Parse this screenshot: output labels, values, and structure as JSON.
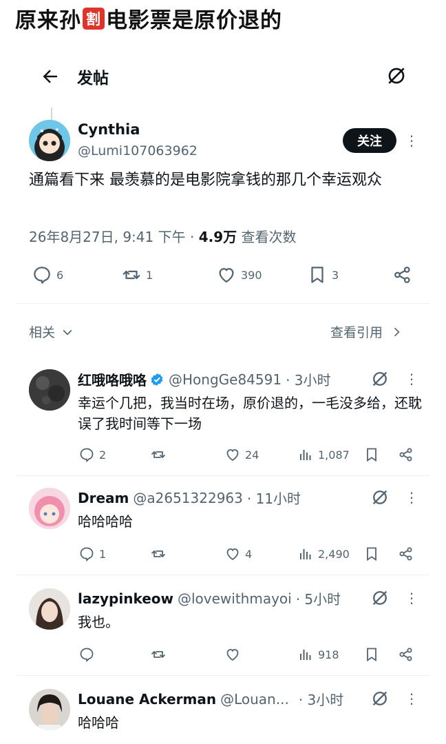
{
  "caption": {
    "before": "原来孙",
    "emoji": "割",
    "after": "电影票是原价退的"
  },
  "topbar": {
    "title": "发帖"
  },
  "main_post": {
    "name": "Cynthia",
    "handle": "@Lumi107063962",
    "follow_label": "关注",
    "text": "通篇看下来 最羡慕的是电影院拿钱的那几个幸运观众",
    "timestamp": "26年8月27日, 9:41 下午",
    "views_value": "4.9万",
    "views_label": "查看次数",
    "replies": "6",
    "reposts": "1",
    "likes": "390",
    "bookmarks": "3"
  },
  "related": {
    "label": "相关",
    "quotes_label": "查看引用"
  },
  "replies": [
    {
      "name": "红哦咯哦咯",
      "verified": true,
      "handle": "@HongGe84591",
      "time": "· 3小时",
      "text": "幸运个几把，我当时在场，原价退的，一毛没多给，还耽误了我时间等下一场",
      "replies": "2",
      "reposts": "",
      "likes": "24",
      "views": "1,087"
    },
    {
      "name": "Dream",
      "verified": false,
      "handle": "@a2651322963",
      "time": "· 11小时",
      "text": "哈哈哈哈",
      "replies": "1",
      "reposts": "",
      "likes": "4",
      "views": "2,490"
    },
    {
      "name": "lazypinkeow",
      "verified": false,
      "handle": "@lovewithmayoi",
      "time": "· 5小时",
      "text": "我也。",
      "replies": "",
      "reposts": "",
      "likes": "",
      "views": "918"
    },
    {
      "name": "Louane Ackerman",
      "verified": false,
      "handle": "@Louan...",
      "time": "· 3小时",
      "text": "哈哈哈",
      "replies": "",
      "reposts": "",
      "likes": "",
      "views": ""
    }
  ],
  "colors": {
    "text": "#0f1419",
    "muted": "#536471",
    "verified": "#1d9bf0",
    "caption_emoji_bg": "#e0342b"
  }
}
